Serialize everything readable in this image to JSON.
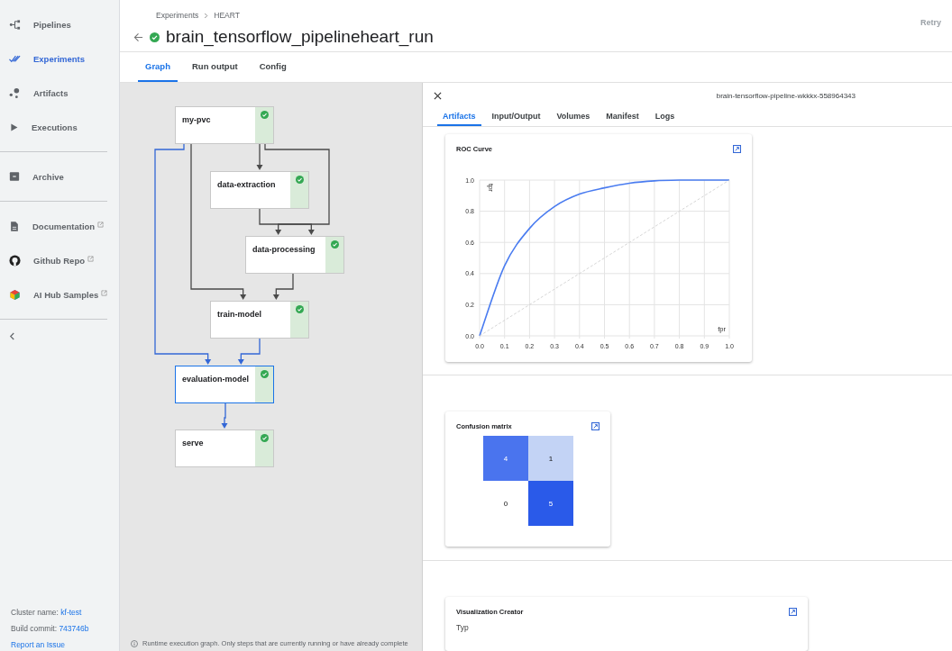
{
  "sidebar": {
    "sections": [
      {
        "items": [
          {
            "label": "Pipelines",
            "selected": false,
            "external": false
          },
          {
            "label": "Experiments",
            "selected": true,
            "external": false
          },
          {
            "label": "Artifacts",
            "selected": false,
            "external": false
          },
          {
            "label": "Executions",
            "selected": false,
            "external": false
          }
        ]
      },
      {
        "items": [
          {
            "label": "Archive",
            "selected": false,
            "external": false
          }
        ]
      },
      {
        "items": [
          {
            "label": "Documentation",
            "selected": false,
            "external": true
          },
          {
            "label": "Github Repo",
            "selected": false,
            "external": true
          },
          {
            "label": "AI Hub Samples",
            "selected": false,
            "external": true
          }
        ]
      }
    ],
    "footer": {
      "cluster_label": "Cluster name:",
      "cluster": "kf-test",
      "commit_label": "Build commit:",
      "commit": "743746b",
      "report_link": "Report an Issue"
    }
  },
  "header": {
    "breadcrumbs": [
      "Experiments",
      "HEART"
    ],
    "title": "brain_tensorflow_pipelineheart_run",
    "retry": {
      "label": "Retry",
      "disabled": true
    }
  },
  "tabs": [
    {
      "label": "Graph",
      "selected": true
    },
    {
      "label": "Run output",
      "selected": false
    },
    {
      "label": "Config",
      "selected": false
    }
  ],
  "graph": {
    "nodes": [
      {
        "label": "my-pvc",
        "selected": false
      },
      {
        "label": "data-extraction",
        "selected": false
      },
      {
        "label": "data-processing",
        "selected": false
      },
      {
        "label": "train-model",
        "selected": false
      },
      {
        "label": "evaluation-model",
        "selected": true
      },
      {
        "label": "serve",
        "selected": false
      }
    ],
    "edges": [
      {
        "highlighted": false
      },
      {
        "highlighted": false
      },
      {
        "highlighted": false
      },
      {
        "highlighted": true
      },
      {
        "highlighted": false
      },
      {
        "highlighted": false
      },
      {
        "highlighted": true
      },
      {
        "highlighted": true
      }
    ],
    "info": "Runtime execution graph. Only steps that are currently running or have already complete"
  },
  "side_panel": {
    "run_id": "brain-tensorflow-pipeline-wkkkx-558964343",
    "tabs": [
      {
        "label": "Artifacts",
        "selected": true
      },
      {
        "label": "Input/Output",
        "selected": false
      },
      {
        "label": "Volumes",
        "selected": false
      },
      {
        "label": "Manifest",
        "selected": false
      },
      {
        "label": "Logs",
        "selected": false
      }
    ],
    "roc": {
      "title": "ROC Curve",
      "chart_data": {
        "type": "line",
        "xlabel": "fpr",
        "ylabel": "tpr",
        "x": [
          0,
          0.1,
          0.2,
          0.3,
          0.4,
          0.5,
          0.6,
          0.7,
          0.8,
          0.9,
          1
        ],
        "series": [
          {
            "color": "#4a7cf0",
            "line_style": "solid",
            "values": [
              0,
              0.45,
              0.69,
              0.83,
              0.91,
              0.95,
              0.98,
              0.995,
              1,
              1,
              1
            ]
          },
          {
            "color": "#cccccc",
            "line_style": "dashed",
            "values": [
              0,
              0.1,
              0.2,
              0.3,
              0.4,
              0.5,
              0.6,
              0.7,
              0.8,
              0.9,
              1
            ]
          }
        ],
        "xlim": [
          0,
          1
        ],
        "ylim": [
          0,
          1
        ],
        "grid": true,
        "xticks": [
          {
            "value": 0,
            "label": "0.0"
          },
          {
            "value": 0.1,
            "label": "0.1"
          },
          {
            "value": 0.2,
            "label": "0.2"
          },
          {
            "value": 0.3,
            "label": "0.3"
          },
          {
            "value": 0.4,
            "label": "0.4"
          },
          {
            "value": 0.5,
            "label": "0.5"
          },
          {
            "value": 0.6,
            "label": "0.6"
          },
          {
            "value": 0.7,
            "label": "0.7"
          },
          {
            "value": 0.8,
            "label": "0.8"
          },
          {
            "value": 0.9,
            "label": "0.9"
          },
          {
            "value": 1,
            "label": "1.0"
          }
        ],
        "yticks": [
          {
            "value": 0,
            "label": "0.0"
          },
          {
            "value": 0.2,
            "label": "0.2"
          },
          {
            "value": 0.4,
            "label": "0.4"
          },
          {
            "value": 0.6,
            "label": "0.6"
          },
          {
            "value": 0.8,
            "label": "0.8"
          },
          {
            "value": 1,
            "label": "1.0"
          }
        ]
      }
    },
    "confusion": {
      "title": "Confusion matrix",
      "rows": [
        [
          {
            "value": "4",
            "color": "#4a74ee"
          },
          {
            "value": "1",
            "color": "#c3d3f5"
          }
        ],
        [
          {
            "value": "0",
            "color": "#ffffff"
          },
          {
            "value": "5",
            "color": "#2a5ae9"
          }
        ]
      ]
    },
    "viz": {
      "title": "Visualization Creator",
      "field_label": "Typ"
    }
  }
}
